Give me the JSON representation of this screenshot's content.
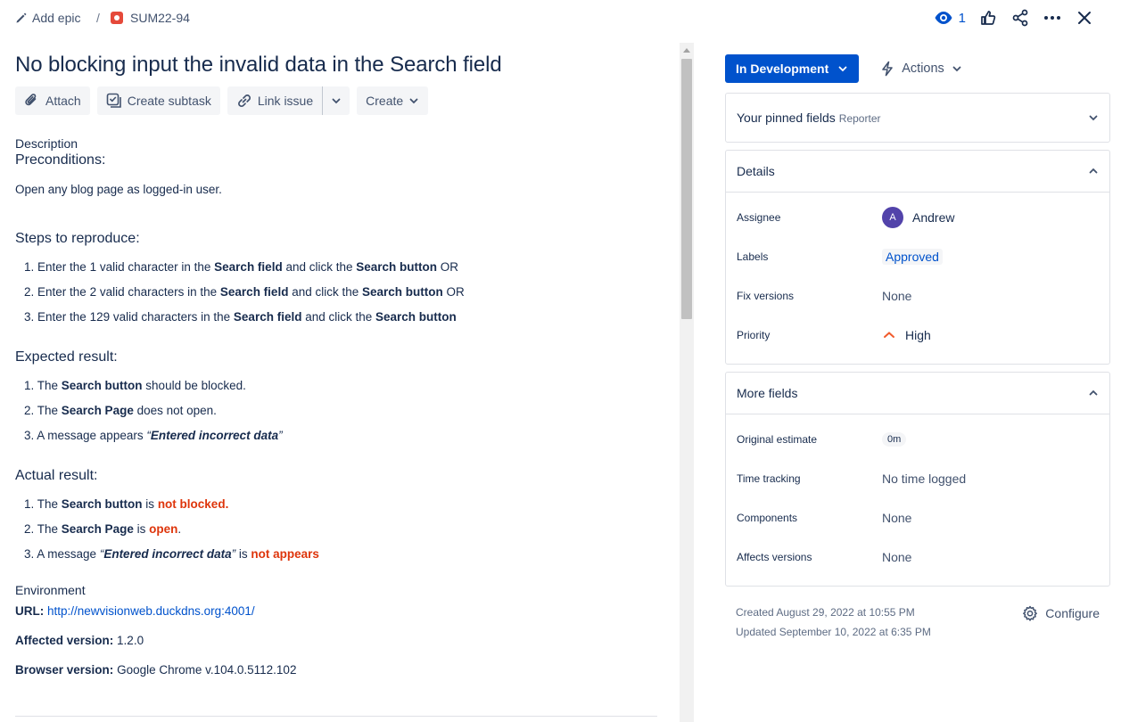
{
  "breadcrumb": {
    "epic_label": "Add epic",
    "separator": "/",
    "issue_key": "SUM22-94"
  },
  "top_actions": {
    "watch_count": "1"
  },
  "issue": {
    "title": "No blocking input the invalid data in the Search field"
  },
  "toolbar": {
    "attach": "Attach",
    "create_subtask": "Create subtask",
    "link_issue": "Link issue",
    "create": "Create"
  },
  "description": {
    "label": "Description",
    "preconditions_heading": "Preconditions:",
    "preconditions_text": "Open any blog page as logged-in user.",
    "steps_heading": "Steps to reproduce:",
    "steps": [
      {
        "n": "1.",
        "a": "Enter the 1 valid character in the ",
        "b1": "Search field",
        "c": " and click the ",
        "b2": "Search button",
        "d": "  OR"
      },
      {
        "n": "2.",
        "a": "Enter the 2 valid characters in the ",
        "b1": "Search field",
        "c": " and click the ",
        "b2": "Search button",
        "d": "  OR"
      },
      {
        "n": "3.",
        "a": "Enter the 129 valid characters in the ",
        "b1": "Search field",
        "c": " and click the ",
        "b2": "Search button",
        "d": ""
      }
    ],
    "expected_heading": "Expected result:",
    "expected": [
      {
        "n": "1. The ",
        "b": "Search button",
        "rest": " should be blocked."
      },
      {
        "n": "2. The ",
        "b": "Search Page",
        "rest": " does not open."
      },
      {
        "n": "3. A message appears ",
        "q_open": "“",
        "b": "Entered incorrect data",
        "q_close": "”"
      }
    ],
    "actual_heading": "Actual result:",
    "actual": [
      {
        "n": "1. The ",
        "b": "Search button",
        "mid": " is ",
        "red": "not blocked."
      },
      {
        "n": "2. The ",
        "b": "Search Page",
        "mid": " is ",
        "red": "open",
        "tail": "."
      },
      {
        "n": "3. A message ",
        "q_open": "“",
        "b": "Entered incorrect data",
        "q_close": "”",
        "mid": " is ",
        "red": "not appears"
      }
    ]
  },
  "environment": {
    "label": "Environment",
    "url_label": "URL:",
    "url_value": "http://newvisionweb.duckdns.org:4001/",
    "version_label": "Affected version:",
    "version_value": "1.2.0",
    "browser_label": "Browser version:",
    "browser_value": "Google Chrome v.104.0.5112.102"
  },
  "sidebar": {
    "status": "In Development",
    "actions": "Actions",
    "pinned": {
      "label": "Your pinned fields",
      "hint": "Reporter"
    },
    "details": {
      "label": "Details",
      "fields": [
        {
          "label": "Assignee",
          "value": "Andrew",
          "avatar": "A"
        },
        {
          "label": "Labels",
          "value": "Approved"
        },
        {
          "label": "Fix versions",
          "value": "None"
        },
        {
          "label": "Priority",
          "value": "High"
        }
      ]
    },
    "more": {
      "label": "More fields",
      "fields": [
        {
          "label": "Original estimate",
          "value": "0m"
        },
        {
          "label": "Time tracking",
          "value": "No time logged"
        },
        {
          "label": "Components",
          "value": "None"
        },
        {
          "label": "Affects versions",
          "value": "None"
        }
      ]
    },
    "created": "Created August 29, 2022 at 10:55 PM",
    "updated": "Updated September 10, 2022 at 6:35 PM",
    "configure": "Configure"
  },
  "colors": {
    "primary": "#0052cc",
    "text": "#172b4d",
    "bug": "#e5493a",
    "danger": "#de350b",
    "priority_high": "#f15b2c"
  },
  "icons": [
    "pencil-icon",
    "bug-icon",
    "eye-icon",
    "thumbs-up-icon",
    "share-icon",
    "more-icon",
    "close-icon",
    "paperclip-icon",
    "subtask-icon",
    "link-icon",
    "chevron-down-icon",
    "lightning-icon",
    "chevron-up-icon",
    "priority-high-icon",
    "gear-icon"
  ]
}
